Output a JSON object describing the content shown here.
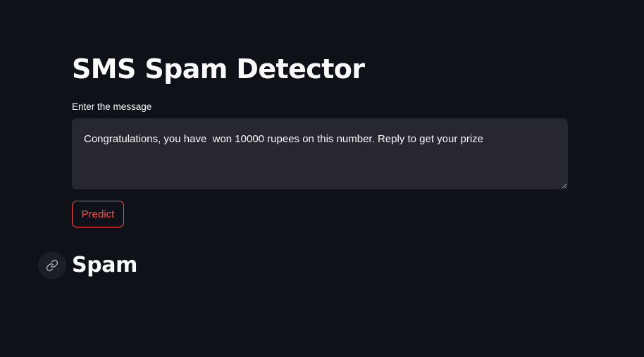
{
  "app": {
    "title": "SMS Spam Detector"
  },
  "form": {
    "message_label": "Enter the message",
    "message_value": "Congratulations, you have  won 10000 rupees on this number. Reply to get your prize",
    "predict_label": "Predict"
  },
  "result": {
    "label": "Spam",
    "anchor_icon": "link-icon"
  },
  "colors": {
    "background": "#0e1117",
    "input_background": "#262730",
    "accent": "#ff4b4b",
    "text": "#fafafa"
  }
}
